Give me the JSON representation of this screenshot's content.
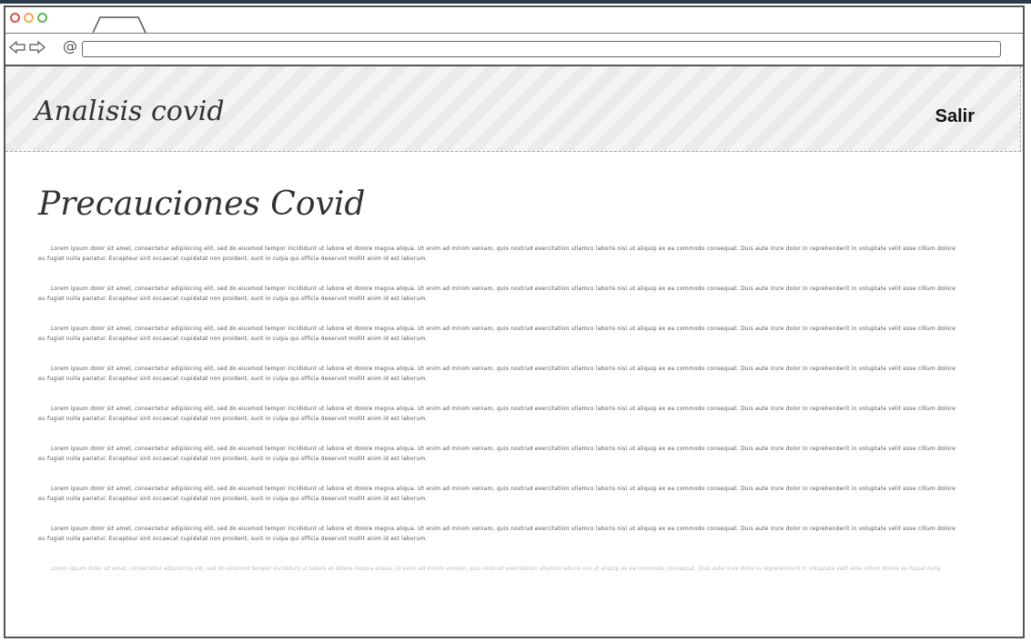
{
  "header": {
    "brand": "Analisis covid",
    "logout_label": "Salir"
  },
  "main": {
    "title": "Precauciones Covid",
    "paragraphs": [
      "Lorem ipsum dolor sit amet, consectetur adipisicing elit, sed do eiusmod tempor incididunt ut labore et dolore magna aliqua. Ut enim ad minim veniam, quis nostrud exercitation ullamco laboris nisi ut aliquip ex ea commodo consequat. Duis aute irure dolor in reprehenderit in voluptate velit esse cillum dolore eu fugiat nulla pariatur. Excepteur sint occaecat cupidatat non proident, sunt in culpa qui officia deserunt mollit anim id est laborum.",
      "Lorem ipsum dolor sit amet, consectetur adipisicing elit, sed do eiusmod tempor incididunt ut labore et dolore magna aliqua. Ut enim ad minim veniam, quis nostrud exercitation ullamco laboris nisi ut aliquip ex ea commodo consequat. Duis aute irure dolor in reprehenderit in voluptate velit esse cillum dolore eu fugiat nulla pariatur. Excepteur sint occaecat cupidatat non proident, sunt in culpa qui officia deserunt mollit anim id est laborum.",
      "Lorem ipsum dolor sit amet, consectetur adipisicing elit, sed do eiusmod tempor incididunt ut labore et dolore magna aliqua. Ut enim ad minim veniam, quis nostrud exercitation ullamco laboris nisi ut aliquip ex ea commodo consequat. Duis aute irure dolor in reprehenderit in voluptate velit esse cillum dolore eu fugiat nulla pariatur. Excepteur sint occaecat cupidatat non proident, sunt in culpa qui officia deserunt mollit anim id est laborum.",
      "Lorem ipsum dolor sit amet, consectetur adipisicing elit, sed do eiusmod tempor incididunt ut labore et dolore magna aliqua. Ut enim ad minim veniam, quis nostrud exercitation ullamco laboris nisi ut aliquip ex ea commodo consequat. Duis aute irure dolor in reprehenderit in voluptate velit esse cillum dolore eu fugiat nulla pariatur. Excepteur sint occaecat cupidatat non proident, sunt in culpa qui officia deserunt mollit anim id est laborum.",
      "Lorem ipsum dolor sit amet, consectetur adipisicing elit, sed do eiusmod tempor incididunt ut labore et dolore magna aliqua. Ut enim ad minim veniam, quis nostrud exercitation ullamco laboris nisi ut aliquip ex ea commodo consequat. Duis aute irure dolor in reprehenderit in voluptate velit esse cillum dolore eu fugiat nulla pariatur. Excepteur sint occaecat cupidatat non proident, sunt in culpa qui officia deserunt mollit anim id est laborum.",
      "Lorem ipsum dolor sit amet, consectetur adipisicing elit, sed do eiusmod tempor incididunt ut labore et dolore magna aliqua. Ut enim ad minim veniam, quis nostrud exercitation ullamco laboris nisi ut aliquip ex ea commodo consequat. Duis aute irure dolor in reprehenderit in voluptate velit esse cillum dolore eu fugiat nulla pariatur. Excepteur sint occaecat cupidatat non proident, sunt in culpa qui officia deserunt mollit anim id est laborum.",
      "Lorem ipsum dolor sit amet, consectetur adipisicing elit, sed do eiusmod tempor incididunt ut labore et dolore magna aliqua. Ut enim ad minim veniam, quis nostrud exercitation ullamco laboris nisi ut aliquip ex ea commodo consequat. Duis aute irure dolor in reprehenderit in voluptate velit esse cillum dolore eu fugiat nulla pariatur. Excepteur sint occaecat cupidatat non proident, sunt in culpa qui officia deserunt mollit anim id est laborum.",
      "Lorem ipsum dolor sit amet, consectetur adipisicing elit, sed do eiusmod tempor incididunt ut labore et dolore magna aliqua. Ut enim ad minim veniam, quis nostrud exercitation ullamco laboris nisi ut aliquip ex ea commodo consequat. Duis aute irure dolor in reprehenderit in voluptate velit esse cillum dolore eu fugiat nulla pariatur. Excepteur sint occaecat cupidatat non proident, sunt in culpa qui officia deserunt mollit anim id est laborum."
    ],
    "faded_paragraph": "Lorem ipsum dolor sit amet, consectetur adipisicing elit, sed do eiusmod tempor incididunt ut labore et dolore magna aliqua. Ut enim ad minim veniam, quis nostrud exercitation ullamco laboris nisi ut aliquip ex ea commodo consequat. Duis aute irure dolor in reprehenderit in voluptate velit esse cillum dolore eu fugiat nulla pariatur."
  },
  "icons": {
    "window_controls": [
      "close-icon",
      "minimize-icon",
      "maximize-icon"
    ],
    "nav": [
      "back-arrow-icon",
      "forward-arrow-icon",
      "at-sign-icon"
    ]
  },
  "colors": {
    "close": "#d9534f",
    "minimize": "#f0ad4e",
    "maximize": "#5cb85c"
  }
}
